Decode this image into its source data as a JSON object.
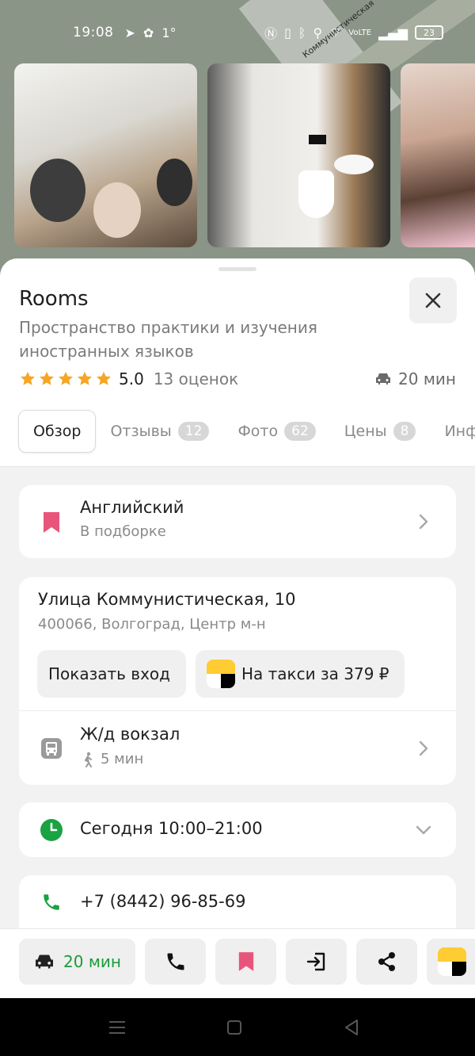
{
  "status_bar": {
    "time": "19:08",
    "temperature": "1°",
    "battery": "23"
  },
  "map": {
    "street_label": "Коммунистическая"
  },
  "place": {
    "name": "Rooms",
    "description": "Пространство практики и изучения иностранных языков",
    "rating": "5.0",
    "rating_count": "13 оценок",
    "drive_time": "20 мин",
    "stars": 5
  },
  "tabs": [
    {
      "label": "Обзор",
      "badge": null,
      "active": true
    },
    {
      "label": "Отзывы",
      "badge": "12"
    },
    {
      "label": "Фото",
      "badge": "62"
    },
    {
      "label": "Цены",
      "badge": "8"
    },
    {
      "label": "Инф"
    }
  ],
  "collection": {
    "title": "Английский",
    "subtitle": "В подборке"
  },
  "address": {
    "street": "Улица Коммунистическая, 10",
    "city": "400066, Волгоград, Центр м-н",
    "show_entrance_label": "Показать вход",
    "taxi_label": "На такси за 379 ₽"
  },
  "transit": {
    "station": "Ж/д вокзал",
    "walk_time": "5 мин"
  },
  "hours": {
    "label": "Сегодня 10:00–21:00"
  },
  "phone": {
    "number": "+7 (8442) 96-85-69"
  },
  "actions": {
    "route_time": "20 мин"
  },
  "colors": {
    "accent_green": "#1a9b3a",
    "star": "#f5a623",
    "bookmark": "#e8557a",
    "clock_green": "#1aa243"
  }
}
